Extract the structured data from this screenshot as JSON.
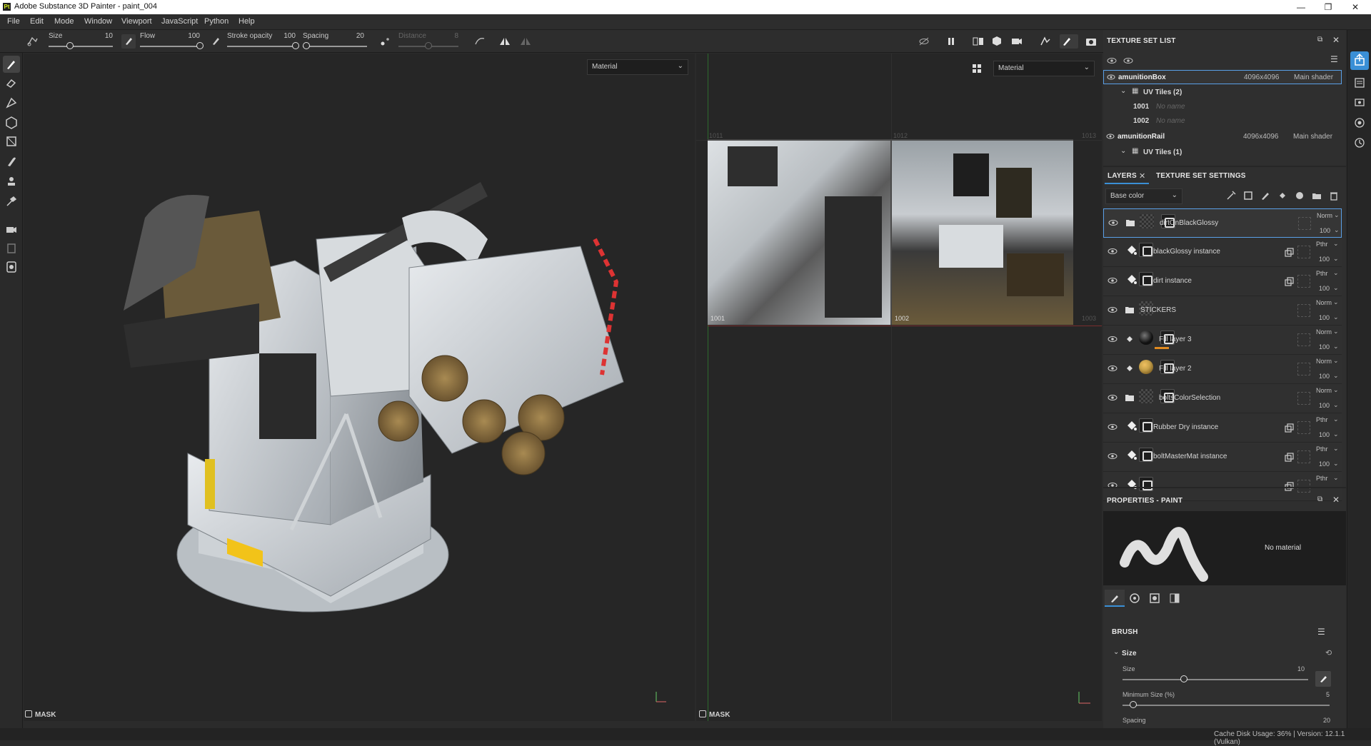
{
  "app": {
    "title": "Adobe Substance 3D Painter - paint_004",
    "icon_text": "Pt"
  },
  "window_controls": {
    "minimize": "—",
    "maximize": "❐",
    "close": "✕"
  },
  "menu": [
    "File",
    "Edit",
    "Mode",
    "Window",
    "Viewport",
    "JavaScript",
    "Python",
    "Help"
  ],
  "toolbar": {
    "size_label": "Size",
    "size_value": "10",
    "size_fraction": 0.33,
    "flow_label": "Flow",
    "flow_value": "100",
    "flow_fraction": 1.0,
    "stroke_opacity_label": "Stroke opacity",
    "stroke_opacity_value": "100",
    "stroke_opacity_fraction": 1.0,
    "spacing_label": "Spacing",
    "spacing_value": "20",
    "spacing_fraction": 0.05,
    "distance_label": "Distance",
    "distance_value": "8",
    "distance_fraction": 0.5
  },
  "viewport3d": {
    "dropdown": "Material",
    "mask_label": "MASK"
  },
  "viewport2d": {
    "dropdown": "Material",
    "mask_label": "MASK",
    "tiles": {
      "t1011": "1011",
      "t1012": "1012",
      "t1013": "1013",
      "t1001": "1001",
      "t1002": "1002",
      "t1003": "1003"
    }
  },
  "texture_set_list": {
    "title": "TEXTURE SET LIST",
    "sets": [
      {
        "name": "amunitionBox",
        "res": "4096x4096",
        "shader": "Main shader",
        "uv_label": "UV Tiles (2)",
        "tiles": [
          {
            "id": "1001",
            "name": "No name"
          },
          {
            "id": "1002",
            "name": "No name"
          }
        ]
      },
      {
        "name": "amunitionRail",
        "res": "4096x4096",
        "shader": "Main shader",
        "uv_label": "UV Tiles (1)"
      }
    ]
  },
  "layers_panel": {
    "tab_layers": "LAYERS",
    "tab_tss": "TEXTURE SET SETTINGS",
    "channel": "Base color",
    "layers": [
      {
        "name": "dirtOnBlackGlossy",
        "blend": "Norm",
        "opacity": "100",
        "kind": "folder"
      },
      {
        "name": "blackGlossy instance",
        "blend": "Pthr",
        "opacity": "100",
        "kind": "fill-instance"
      },
      {
        "name": "dirt instance",
        "blend": "Pthr",
        "opacity": "100",
        "kind": "fill-instance"
      },
      {
        "name": "STICKERS",
        "blend": "Norm",
        "opacity": "100",
        "kind": "folder-open"
      },
      {
        "name": "Fill layer 3",
        "blend": "Norm",
        "opacity": "100",
        "kind": "fill-dark"
      },
      {
        "name": "Fill layer 2",
        "blend": "Norm",
        "opacity": "100",
        "kind": "fill-gold"
      },
      {
        "name": "boltsColorSelection",
        "blend": "Norm",
        "opacity": "100",
        "kind": "folder"
      },
      {
        "name": "Rubber Dry instance",
        "blend": "Pthr",
        "opacity": "100",
        "kind": "fill-instance"
      },
      {
        "name": "boltMasterMat instance",
        "blend": "Pthr",
        "opacity": "100",
        "kind": "fill-instance"
      },
      {
        "blend": "Pthr",
        "kind": "fill-instance"
      }
    ]
  },
  "properties": {
    "title": "PROPERTIES - PAINT",
    "no_material": "No material",
    "brush_label": "BRUSH",
    "size_group": "Size",
    "size_label": "Size",
    "size_value": "10",
    "size_fraction": 0.33,
    "min_size_label": "Minimum Size (%)",
    "min_size_value": "5",
    "min_size_fraction": 0.05,
    "spacing_label": "Spacing",
    "spacing_value": "20"
  },
  "statusbar": {
    "text": "Cache Disk Usage:    36% | Version: 12.1.1 (Vulkan)"
  },
  "colors": {
    "accent": "#3a8fd6",
    "panel": "#2f2f2f",
    "viewport": "#262626",
    "highlight_border": "#5aa0e8",
    "gold": "#c8a24a"
  }
}
